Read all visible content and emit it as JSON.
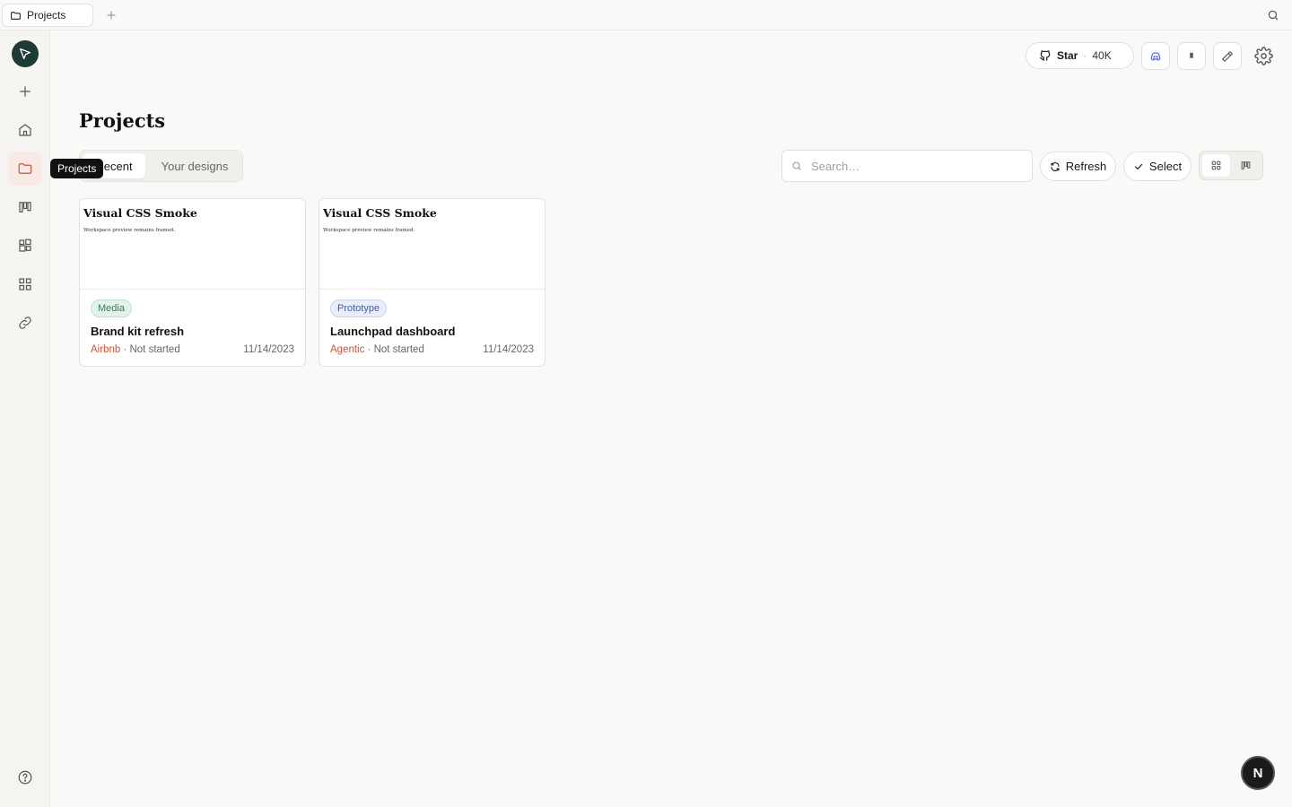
{
  "tabbar": {
    "tab_label": "Projects"
  },
  "sidebar": {
    "tooltip": "Projects",
    "items": [
      {
        "name": "new",
        "icon": "plus-icon"
      },
      {
        "name": "home",
        "icon": "home-icon"
      },
      {
        "name": "projects",
        "icon": "folder-icon",
        "active": true
      },
      {
        "name": "boards",
        "icon": "kanban-icon"
      },
      {
        "name": "components",
        "icon": "components-icon"
      },
      {
        "name": "apps",
        "icon": "grid-icon"
      },
      {
        "name": "links",
        "icon": "link-icon"
      }
    ],
    "help_icon": "help-icon"
  },
  "toolbar": {
    "star_label": "Star",
    "star_count": "40K"
  },
  "main": {
    "title": "Projects",
    "tabs": [
      {
        "label": "Recent",
        "active": true
      },
      {
        "label": "Your designs",
        "active": false
      }
    ],
    "search_placeholder": "Search…",
    "refresh_label": "Refresh",
    "select_label": "Select"
  },
  "cards": [
    {
      "preview_title": "Visual CSS Smoke",
      "preview_sub": "Workspace preview remains framed.",
      "badge": "Media",
      "name": "Brand kit refresh",
      "org": "Airbnb",
      "status": "· Not started",
      "date": "11/14/2023"
    },
    {
      "preview_title": "Visual CSS Smoke",
      "preview_sub": "Workspace preview remains framed.",
      "badge": "Prototype",
      "name": "Launchpad dashboard",
      "org": "Agentic",
      "status": "· Not started",
      "date": "11/14/2023"
    }
  ],
  "fab_label": "N",
  "colors": {
    "accent": "#c8543a",
    "background": "#faf9f7",
    "logo_bg": "#1f3b36"
  }
}
